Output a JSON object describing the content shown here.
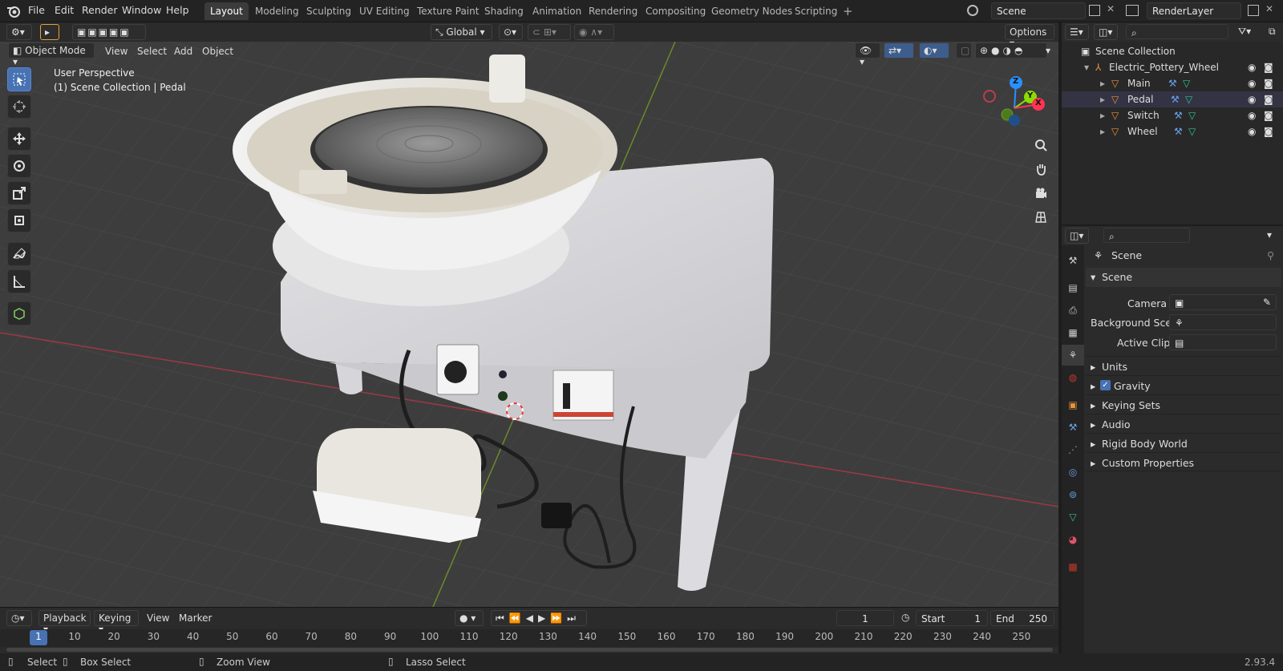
{
  "menus": [
    "File",
    "Edit",
    "Render",
    "Window",
    "Help"
  ],
  "workspaces": [
    "Layout",
    "Modeling",
    "Sculpting",
    "UV Editing",
    "Texture Paint",
    "Shading",
    "Animation",
    "Rendering",
    "Compositing",
    "Geometry Nodes",
    "Scripting"
  ],
  "active_workspace": "Layout",
  "scene_name": "Scene",
  "view_layer": "RenderLayer",
  "header": {
    "orientation": "Global",
    "options": "Options",
    "mode": "Object Mode",
    "view": "View",
    "select": "Select",
    "add": "Add",
    "object": "Object"
  },
  "viewport": {
    "perspective": "User Perspective",
    "collection_info": "(1) Scene Collection | Pedal",
    "gizmo": {
      "x": "X",
      "y": "Y",
      "z": "Z"
    }
  },
  "outliner": {
    "root": "Scene Collection",
    "collection": "Electric_Pottery_Wheel",
    "objects": [
      "Main",
      "Pedal",
      "Switch",
      "Wheel"
    ]
  },
  "properties": {
    "context": "Scene",
    "panel": "Scene",
    "fields": [
      {
        "label": "Camera"
      },
      {
        "label": "Background Sce..."
      },
      {
        "label": "Active Clip"
      }
    ],
    "panels": [
      "Units",
      "Gravity",
      "Keying Sets",
      "Audio",
      "Rigid Body World",
      "Custom Properties"
    ],
    "gravity_checked": true
  },
  "timeline": {
    "menus": [
      "Playback",
      "Keying",
      "View",
      "Marker"
    ],
    "current_frame": "1",
    "start_label": "Start",
    "start": "1",
    "end_label": "End",
    "end": "250",
    "ticks": [
      "1",
      "10",
      "20",
      "30",
      "40",
      "50",
      "60",
      "70",
      "80",
      "90",
      "100",
      "110",
      "120",
      "130",
      "140",
      "150",
      "160",
      "170",
      "180",
      "190",
      "200",
      "210",
      "220",
      "230",
      "240",
      "250"
    ]
  },
  "statusbar": {
    "select": "Select",
    "box_select": "Box Select",
    "zoom_view": "Zoom View",
    "lasso_select": "Lasso Select",
    "version": "2.93.4"
  },
  "colors": {
    "accent": "#4772b3",
    "x_axis": "#ff3352",
    "y_axis": "#8bdc00",
    "z_axis": "#2890ff",
    "object_orange": "#e5923b"
  }
}
